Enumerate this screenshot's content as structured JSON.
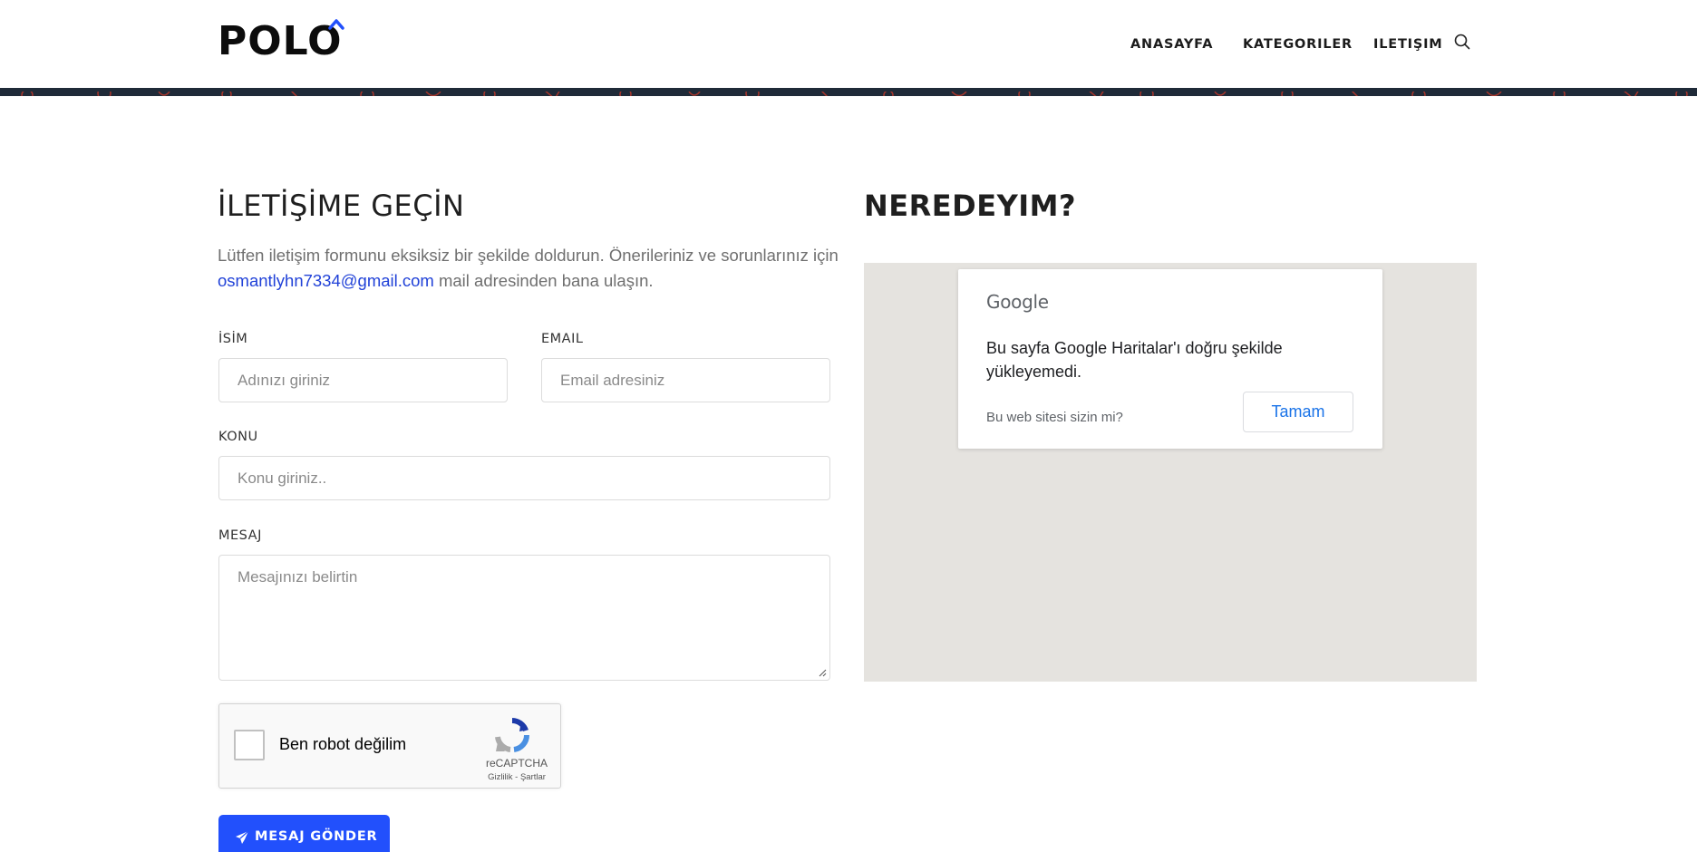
{
  "header": {
    "logo_text": "POLO",
    "nav": [
      "ANASAYFA",
      "KATEGORILER",
      "ILETIŞIM"
    ],
    "search_icon": "search-icon",
    "pattern_color": "#1f2a38",
    "accent": "#2250fc"
  },
  "contact": {
    "title": "İLETİŞİME GEÇİN",
    "intro_before": "Lütfen iletişim formunu eksiksiz bir şekilde doldurun. Önerileriniz ve sorunlarınız için ",
    "email_link": "osmantlyhn7334@gmail.com",
    "intro_after": " mail adresinden bana ulaşın.",
    "fields": {
      "name_label": "İSİM",
      "name_placeholder": "Adınızı giriniz",
      "email_label": "EMAIL",
      "email_placeholder": "Email adresiniz",
      "subject_label": "KONU",
      "subject_placeholder": "Konu giriniz..",
      "message_label": "MESAJ",
      "message_placeholder": "Mesajınızı belirtin"
    },
    "captcha": {
      "label": "Ben robot değilim",
      "brand": "reCAPTCHA",
      "terms": "Gizlilik - Şartlar"
    },
    "send_button": "MESAJ GÖNDER"
  },
  "map": {
    "title": "NEREDEYIM?",
    "google_logo": "Google",
    "message": "Bu sayfa Google Haritalar'ı doğru şekilde yükleyemedi.",
    "owner_question": "Bu web sitesi sizin mi?",
    "ok_button": "Tamam",
    "background": "#e5e3df"
  }
}
